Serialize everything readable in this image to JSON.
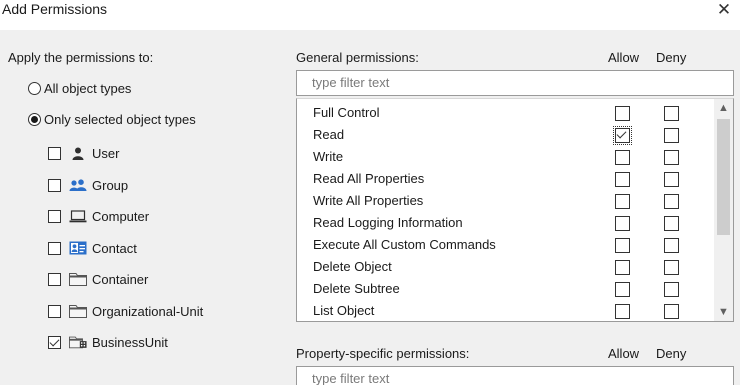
{
  "window": {
    "title": "Add Permissions"
  },
  "left": {
    "heading": "Apply the permissions to:",
    "options": [
      {
        "label": "All object types",
        "selected": false
      },
      {
        "label": "Only selected object types",
        "selected": true
      }
    ],
    "types": [
      {
        "label": "User",
        "icon": "user-icon",
        "checked": false
      },
      {
        "label": "Group",
        "icon": "group-icon",
        "checked": false
      },
      {
        "label": "Computer",
        "icon": "computer-icon",
        "checked": false
      },
      {
        "label": "Contact",
        "icon": "contact-icon",
        "checked": false
      },
      {
        "label": "Container",
        "icon": "folder-icon",
        "checked": false
      },
      {
        "label": "Organizational-Unit",
        "icon": "ou-folder-icon",
        "checked": false
      },
      {
        "label": "BusinessUnit",
        "icon": "business-unit-icon",
        "checked": true
      }
    ]
  },
  "general": {
    "label": "General permissions:",
    "allow": "Allow",
    "deny": "Deny",
    "filter_placeholder": "type filter text",
    "permissions": [
      {
        "name": "Full Control",
        "allow": false,
        "deny": false
      },
      {
        "name": "Read",
        "allow": true,
        "deny": false
      },
      {
        "name": "Write",
        "allow": false,
        "deny": false
      },
      {
        "name": "Read All Properties",
        "allow": false,
        "deny": false
      },
      {
        "name": "Write All Properties",
        "allow": false,
        "deny": false
      },
      {
        "name": "Read Logging Information",
        "allow": false,
        "deny": false
      },
      {
        "name": "Execute All Custom Commands",
        "allow": false,
        "deny": false
      },
      {
        "name": "Delete Object",
        "allow": false,
        "deny": false
      },
      {
        "name": "Delete Subtree",
        "allow": false,
        "deny": false
      },
      {
        "name": "List Object",
        "allow": false,
        "deny": false
      }
    ]
  },
  "property": {
    "label": "Property-specific permissions:",
    "allow": "Allow",
    "deny": "Deny",
    "filter_placeholder": "type filter text"
  },
  "icons": {
    "close": "close-icon",
    "scroll_up": "scroll-up-arrow-icon",
    "scroll_down": "scroll-down-arrow-icon"
  },
  "colors": {
    "dialog_bg": "#f0f0f0",
    "icon_blue": "#2b6fc9",
    "folder_gray": "#555555"
  }
}
